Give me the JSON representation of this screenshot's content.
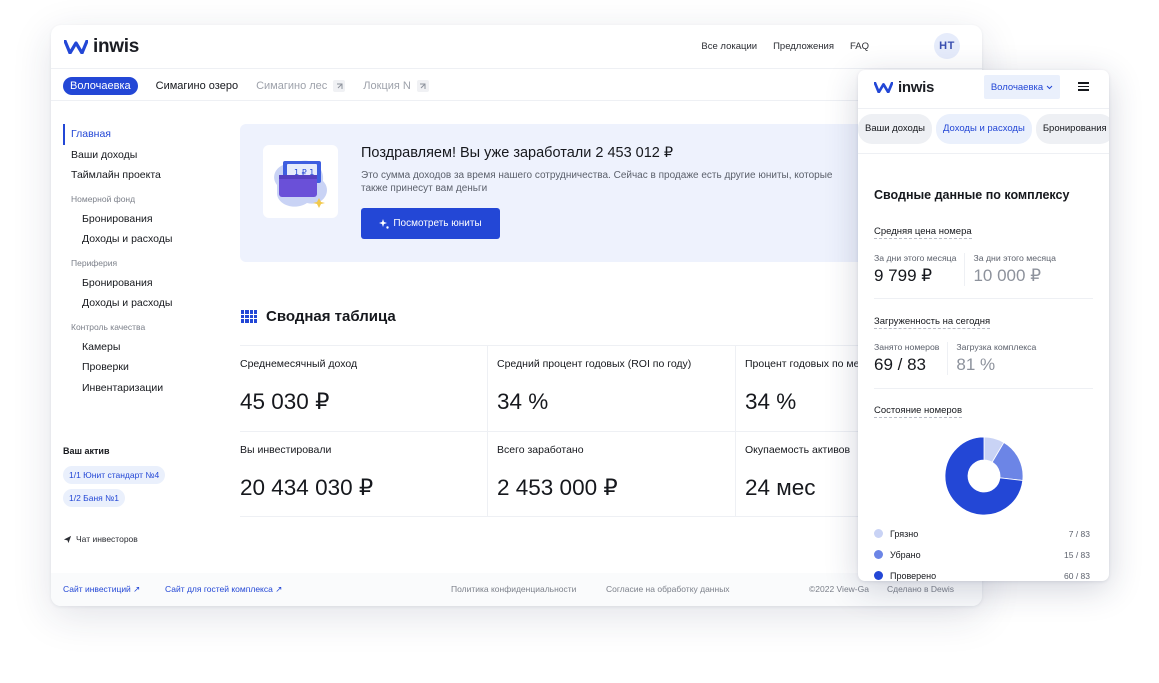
{
  "brand": {
    "name": "inwis",
    "accent": "#2347d6"
  },
  "desktop": {
    "topnav": [
      "Все локации",
      "Предложения",
      "FAQ"
    ],
    "avatar": "НТ",
    "locations": [
      {
        "label": "Волочаевка",
        "state": "active"
      },
      {
        "label": "Симагино озеро",
        "state": "normal"
      },
      {
        "label": "Симагино лес",
        "state": "external"
      },
      {
        "label": "Локция N",
        "state": "external"
      }
    ],
    "sidebar": {
      "main": [
        "Главная",
        "Ваши доходы",
        "Таймлайн проекта"
      ],
      "group1": {
        "title": "Номерной фонд",
        "items": [
          "Бронирования",
          "Доходы и расходы"
        ]
      },
      "group2": {
        "title": "Периферия",
        "items": [
          "Бронирования",
          "Доходы и расходы"
        ]
      },
      "group3": {
        "title": "Контроль качества",
        "items": [
          "Камеры",
          "Проверки",
          "Инвентаризации"
        ]
      }
    },
    "assets": {
      "title": "Ваш актив",
      "chips": [
        "1/1 Юнит стандарт №4",
        "1/2 Баня №1"
      ]
    },
    "chat": "Чат инвесторов",
    "banner": {
      "title": "Поздравляем! Вы уже заработали 2 453 012 ₽",
      "text": "Это сумма доходов за время нашего сотрудничества. Сейчас в продаже есть другие юниты, которые также принесут вам деньги",
      "button": "Посмотреть юниты"
    },
    "summary": {
      "title": "Сводная таблица",
      "cells": [
        {
          "label": "Среднемесячный доход",
          "value": "45 030 ₽"
        },
        {
          "label": "Средний процент годовых (ROI по году)",
          "value": "34 %"
        },
        {
          "label": "Процент годовых по месяцу",
          "value": "34 %"
        },
        {
          "label": "Вы инвестировали",
          "value": "20 434 030 ₽"
        },
        {
          "label": "Всего заработано",
          "value": "2 453 000 ₽"
        },
        {
          "label": "Окупаемость активов",
          "value": "24 мес"
        }
      ]
    },
    "footer": {
      "link1": "Сайт инвестиций",
      "link2": "Сайт для гостей комплекса",
      "privacy": "Политика конфиденциальности",
      "consent": "Согласие на обработку данных",
      "copyright": "©2022 View-Ga",
      "made": "Сделано в Dewis"
    }
  },
  "mobile": {
    "select": "Волочаевка",
    "tabs": [
      "Ваши доходы",
      "Доходы и расходы",
      "Бронирования"
    ],
    "heading": "Сводные данные по комплексу",
    "avg_price": {
      "title": "Средняя цена номера",
      "col1": {
        "label": "За дни этого месяца",
        "value": "9 799 ₽"
      },
      "col2": {
        "label": "За дни этого месяца",
        "value": "10 000 ₽"
      }
    },
    "load": {
      "title": "Загруженность на сегодня",
      "col1": {
        "label": "Занято номеров",
        "value": "69 / 83"
      },
      "col2": {
        "label": "Загрузка комплекса",
        "value": "81 %"
      }
    },
    "rooms": {
      "title": "Состояние номеров",
      "items": [
        {
          "name": "Грязно",
          "count": "7 / 83",
          "value": 7,
          "color": "#c9d3f5"
        },
        {
          "name": "Убрано",
          "count": "15 / 83",
          "value": 15,
          "color": "#6c85e6"
        },
        {
          "name": "Проверено",
          "count": "60 / 83",
          "value": 60,
          "color": "#2347d6"
        }
      ]
    }
  }
}
